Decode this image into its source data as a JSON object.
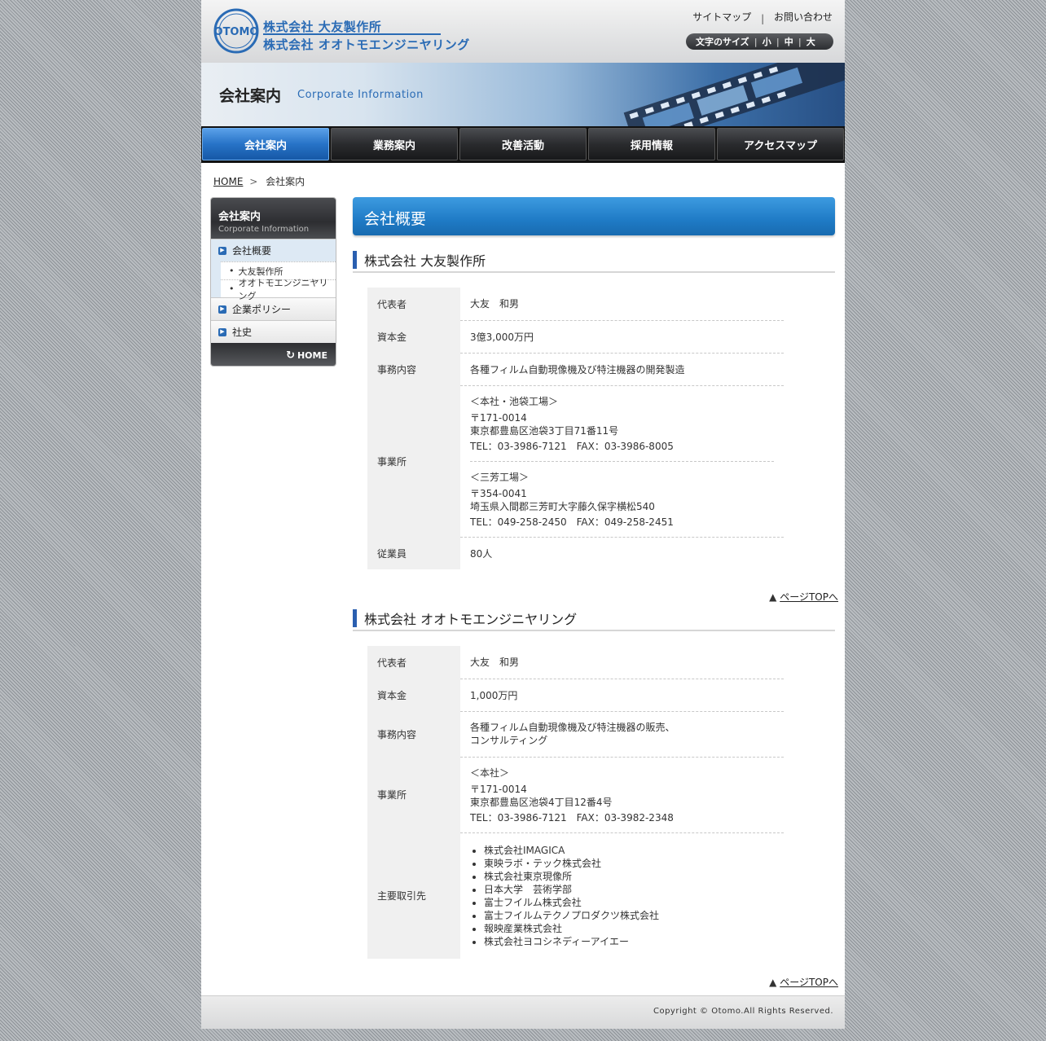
{
  "header": {
    "logo_mark_text": "OTOMO",
    "logo_line_1": "株式会社 大友製作所",
    "logo_line_2": "株式会社 オオトモエンジニヤリング",
    "util_links": {
      "sitemap": "サイトマップ",
      "separator": "|",
      "contact": "お問い合わせ"
    },
    "font_size": {
      "label": "文字のサイズ",
      "small": "小",
      "medium": "中",
      "large": "大",
      "divider": "|"
    }
  },
  "banner": {
    "title": "会社案内",
    "subtitle": "Corporate Information"
  },
  "nav": {
    "items": [
      {
        "label": "会社案内",
        "active": true
      },
      {
        "label": "業務案内"
      },
      {
        "label": "改善活動"
      },
      {
        "label": "採用情報"
      },
      {
        "label": "アクセスマップ"
      }
    ]
  },
  "breadcrumb": {
    "home": "HOME",
    "separator": ">",
    "current": "会社案内"
  },
  "sidebar": {
    "title": "会社案内",
    "subtitle": "Corporate Information",
    "items": [
      {
        "label": "会社概要",
        "active": true,
        "subs": [
          "大友製作所",
          "オオトモエンジニヤリング"
        ]
      },
      {
        "label": "企業ポリシー"
      },
      {
        "label": "社史"
      }
    ],
    "bullet": "•",
    "home": "HOME",
    "home_icon_glyph": "↻"
  },
  "main": {
    "section_title": "会社概要",
    "companies": [
      {
        "name": "株式会社 大友製作所",
        "rows": {
          "rep_label": "代表者",
          "rep": "大友　和男",
          "capital_label": "資本金",
          "capital": "3億3,000万円",
          "business_label": "事務内容",
          "business": "各種フィルム自動現像機及び特注機器の開発製造",
          "office_label": "事業所",
          "offices": [
            {
              "name": "＜本社・池袋工場＞",
              "zip": "〒171-0014",
              "address": "東京都豊島区池袋3丁目71番11号",
              "tel": "TEL：03-3986-7121　FAX：03-3986-8005"
            },
            {
              "name": "＜三芳工場＞",
              "zip": "〒354-0041",
              "address": "埼玉県入間郡三芳町大字藤久保字横松540",
              "tel": "TEL：049-258-2450　FAX：049-258-2451"
            }
          ],
          "employees_label": "従業員",
          "employees": "80人"
        }
      },
      {
        "name": "株式会社 オオトモエンジニヤリング",
        "rows": {
          "rep_label": "代表者",
          "rep": "大友　和男",
          "capital_label": "資本金",
          "capital": "1,000万円",
          "business_label": "事務内容",
          "business_1": "各種フィルム自動現像機及び特注機器の販売、",
          "business_2": "コンサルティング",
          "office_label": "事業所",
          "offices": [
            {
              "name": "＜本社＞",
              "zip": "〒171-0014",
              "address": "東京都豊島区池袋4丁目12番4号",
              "tel": "TEL：03-3986-7121　FAX：03-3982-2348"
            }
          ],
          "clients_label": "主要取引先",
          "clients": [
            "株式会社IMAGICA",
            "東映ラボ・テック株式会社",
            "株式会社東京現像所",
            "日本大学　芸術学部",
            "富士フイルム株式会社",
            "富士フイルムテクノプロダクツ株式会社",
            "報映産業株式会社",
            "株式会社ヨコシネディーアイエー"
          ]
        }
      }
    ],
    "page_top": {
      "arrow": "▲",
      "label": "ページTOPへ"
    }
  },
  "footer": {
    "copyright": "Copyright © Otomo.All Rights Reserved."
  },
  "colors": {
    "brand_blue": "#2a6bb5",
    "nav_active": "#2773c7",
    "nav_dark": "#18191b"
  }
}
